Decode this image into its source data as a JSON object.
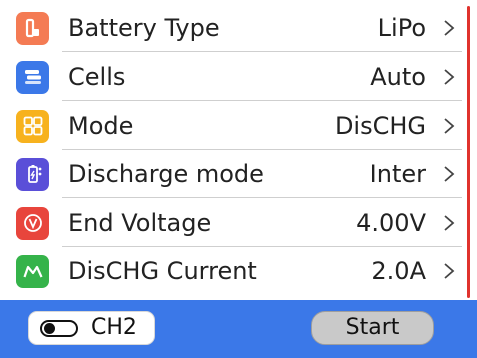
{
  "menu": {
    "items": [
      {
        "label": "Battery Type",
        "value": "LiPo",
        "icon": "battery-icon",
        "color": "#f47b54"
      },
      {
        "label": "Cells",
        "value": "Auto",
        "icon": "layers-icon",
        "color": "#3b78e8"
      },
      {
        "label": "Mode",
        "value": "DisCHG",
        "icon": "grid-icon",
        "color": "#f7b21e"
      },
      {
        "label": "Discharge mode",
        "value": "Inter",
        "icon": "battery-mode-icon",
        "color": "#5a4fd8"
      },
      {
        "label": "End Voltage",
        "value": "4.00V",
        "icon": "voltage-icon",
        "color": "#e8453c"
      },
      {
        "label": "DisCHG Current",
        "value": "2.0A",
        "icon": "current-icon",
        "color": "#35b34a"
      }
    ]
  },
  "footer": {
    "channel_label": "CH2",
    "start_label": "Start",
    "background": "#3b78e8"
  },
  "colors": {
    "scrollbar": "#e0322d"
  }
}
